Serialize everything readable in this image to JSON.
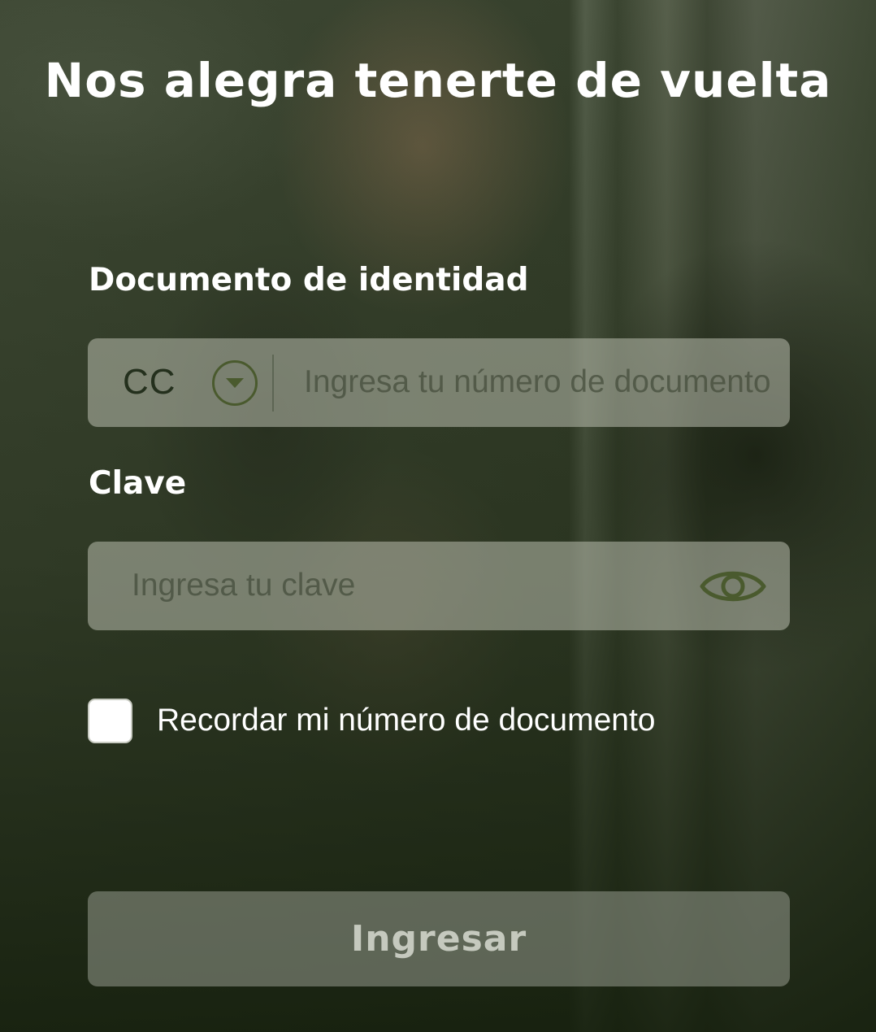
{
  "header": {
    "title": "Nos alegra tenerte de vuelta"
  },
  "document": {
    "label": "Documento de identidad",
    "type_selected": "CC",
    "type_dropdown_icon": "chevron-down-circle-icon",
    "value": "",
    "placeholder": "Ingresa tu número de documento"
  },
  "password": {
    "label": "Clave",
    "value": "",
    "placeholder": "Ingresa tu clave",
    "toggle_icon": "eye-icon"
  },
  "remember": {
    "checked": false,
    "label": "Recordar mi número de documento"
  },
  "submit": {
    "label": "Ingresar",
    "enabled": false
  },
  "colors": {
    "overlay": "#1f2a16",
    "icon": "#4a5a2e",
    "text": "#ffffff"
  }
}
